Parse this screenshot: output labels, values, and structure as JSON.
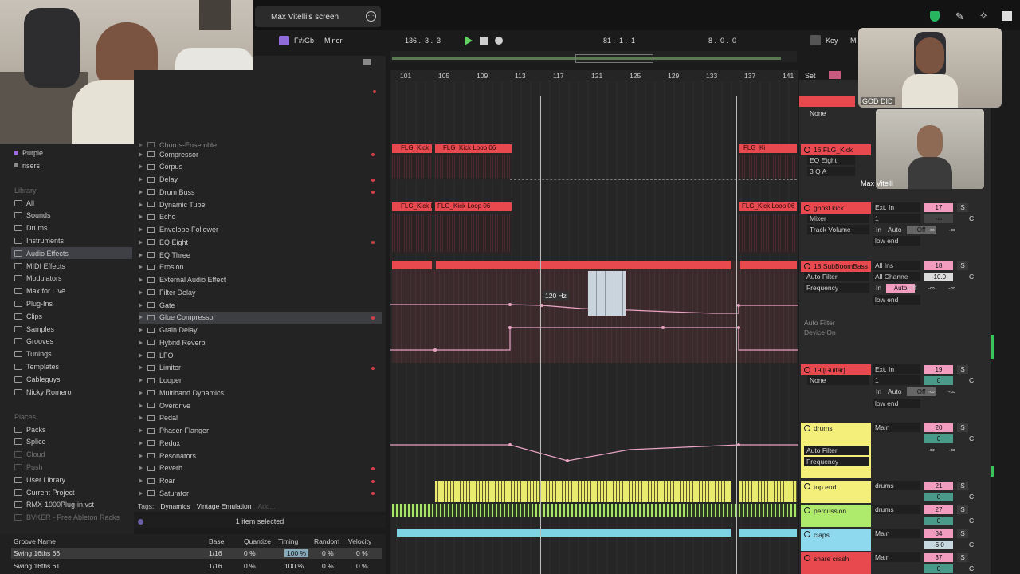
{
  "zoom_title": "Max Vitelli's screen",
  "transport": {
    "key": "F#/Gb",
    "scale": "Minor",
    "position": "136 .  3 .  3",
    "loop_start": "81 .  1 .  1",
    "loop_len": "8 .  0 .  0",
    "key_btn": "Key",
    "midi_btn": "M"
  },
  "ruler": [
    "101",
    "105",
    "109",
    "113",
    "117",
    "121",
    "125",
    "129",
    "133",
    "137",
    "141"
  ],
  "set_label": "Set",
  "sidebar": {
    "collections": [
      {
        "label": "Purple",
        "color": "#9b6de0"
      },
      {
        "label": "risers",
        "color": "#8a8a8a"
      }
    ],
    "library_header": "Library",
    "library": [
      "All",
      "Sounds",
      "Drums",
      "Instruments",
      "Audio Effects",
      "MIDI Effects",
      "Modulators",
      "Max for Live",
      "Plug-Ins",
      "Clips",
      "Samples",
      "Grooves",
      "Tunings",
      "Templates",
      "Cableguys",
      "Nicky Romero"
    ],
    "places_header": "Places",
    "places": [
      "Packs",
      "Splice",
      "Cloud",
      "Push",
      "User Library",
      "Current Project",
      "RMX-1000Plug-in.vst",
      "BVKER - Free Ableton Racks"
    ]
  },
  "browser": {
    "partial": "Chorus-Ensemble",
    "items": [
      "Compressor",
      "Corpus",
      "Delay",
      "Drum Buss",
      "Dynamic Tube",
      "Echo",
      "Envelope Follower",
      "EQ Eight",
      "EQ Three",
      "Erosion",
      "External Audio Effect",
      "Filter Delay",
      "Gate",
      "Glue Compressor",
      "Grain Delay",
      "Hybrid Reverb",
      "LFO",
      "Limiter",
      "Looper",
      "Multiband Dynamics",
      "Overdrive",
      "Pedal",
      "Phaser-Flanger",
      "Redux",
      "Resonators",
      "Reverb",
      "Roar",
      "Saturator"
    ],
    "tags_label": "Tags:",
    "tags": [
      "Dynamics",
      "Vintage Emulation"
    ],
    "tags_add": "Add...",
    "selected_text": "1 item selected"
  },
  "groove": {
    "headers": [
      "Groove Name",
      "Base",
      "Quantize",
      "Timing",
      "Random",
      "Velocity"
    ],
    "rows": [
      {
        "name": "Swing 16ths 66",
        "base": "1/16",
        "quantize": "0 %",
        "timing": "100 %",
        "random": "0 %",
        "velocity": "0 %"
      },
      {
        "name": "Swing 16ths 61",
        "base": "1/16",
        "quantize": "0 %",
        "timing": "100 %",
        "random": "0 %",
        "velocity": "0 %"
      }
    ]
  },
  "clips": {
    "kick1": "FLG_Kick",
    "kick1b": "FLG_Kick Loop 06",
    "kick2": "FLG_Kick L",
    "kick2b": "FLG_Kick Loop 06",
    "kick3": "FLG_Ki",
    "kick4": "FLG_Kick Loop 06",
    "freq_tooltip": "120 Hz"
  },
  "mixer": {
    "none1": "None",
    "t16": {
      "name": "16 FLG_Kick",
      "dev1": "EQ Eight",
      "dev2": "3 Q A"
    },
    "t17": {
      "name": "ghost kick",
      "in": "Ext. In",
      "num": "17",
      "s": "S",
      "d1": "Mixer",
      "d2": "Track Volume",
      "ch": "1",
      "vol": "-∞",
      "c": "C",
      "in_btn": "In",
      "auto": "Auto",
      "off": "Off",
      "sendA": "-∞",
      "sendB": "-∞",
      "out": "low end"
    },
    "t18": {
      "name": "18 SubBoomBass",
      "in": "All Ins",
      "num": "18",
      "s": "S",
      "d1": "Auto Filter",
      "d2": "Frequency",
      "ch": "All Channe",
      "vol": "-10.0",
      "c": "C",
      "in_btn": "In",
      "auto": "Auto",
      "off": "Off",
      "sendA": "-∞",
      "sendB": "-∞",
      "out": "low end",
      "dev_info1": "Auto Filter",
      "dev_info2": "Device On"
    },
    "t19": {
      "name": "19 [Guitar]",
      "in": "Ext. In",
      "num": "19",
      "s": "S",
      "d1": "None",
      "ch": "1",
      "vol": "0",
      "c": "C",
      "in_btn": "In",
      "auto": "Auto",
      "off": "Off",
      "sendA": "-∞",
      "sendB": "-∞",
      "out": "low end"
    },
    "t20": {
      "name": "drums",
      "out": "Main",
      "num": "20",
      "s": "S",
      "vol": "0",
      "c": "C",
      "d1": "Auto Filter",
      "d2": "Frequency",
      "sendA": "-∞",
      "sendB": "-∞"
    },
    "t21": {
      "name": "top end",
      "out": "drums",
      "num": "21",
      "s": "S",
      "vol": "0",
      "c": "C"
    },
    "t27": {
      "name": "percussion",
      "out": "drums",
      "num": "27",
      "s": "S",
      "vol": "0",
      "c": "C"
    },
    "t34": {
      "name": "claps",
      "out": "Main",
      "num": "34",
      "s": "S",
      "vol": "-6.0",
      "c": "C"
    },
    "t37": {
      "name": "snare crash",
      "out": "Main",
      "num": "37",
      "s": "S",
      "vol": "0",
      "c": "C"
    }
  },
  "video": {
    "label_top": "GOD DID",
    "label_bottom": "Max Vitelli"
  }
}
